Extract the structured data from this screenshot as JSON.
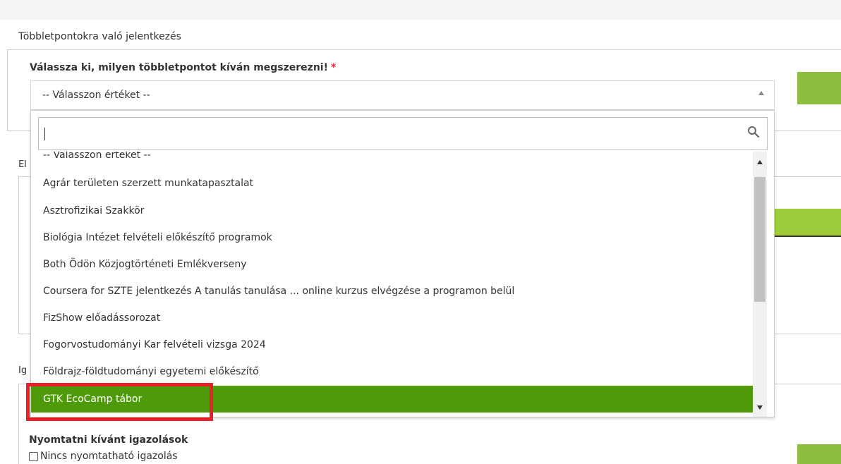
{
  "section": {
    "title": "Többletpontokra való jelentkezés",
    "field_label": "Válassza ki, milyen többletpontot kíván megszerezni!",
    "required_mark": "*",
    "select_value": "-- Válasszon értéket --"
  },
  "background": {
    "label_el": "El",
    "label_ig": "Ig",
    "print_label": "Nyomtatni kívánt igazolások",
    "no_print_text": "Nincs nyomtatható igazolás"
  },
  "dropdown": {
    "search_value": "",
    "options": [
      "-- Válasszon értéket --",
      "Agrár területen szerzett munkatapasztalat",
      "Asztrofizikai Szakkör",
      "Biológia Intézet felvételi előkészítő programok",
      "Both Ödön Közjogtörténeti Emlékverseny",
      "Coursera for SZTE jelentkezés A tanulás tanulása ... online kurzus elvégzése a programon belül",
      "FizShow előadássorozat",
      "Fogorvostudományi Kar felvételi vizsga 2024",
      "Földrajz-földtudományi egyetemi előkészítő",
      "GTK EcoCamp tábor"
    ],
    "selected_option": "GTK EcoCamp tábor"
  },
  "colors": {
    "accent_green": "#4f9a0b",
    "button_green": "#8cbd3f",
    "required_red": "#e0283a",
    "highlight_red": "#e8202a"
  }
}
